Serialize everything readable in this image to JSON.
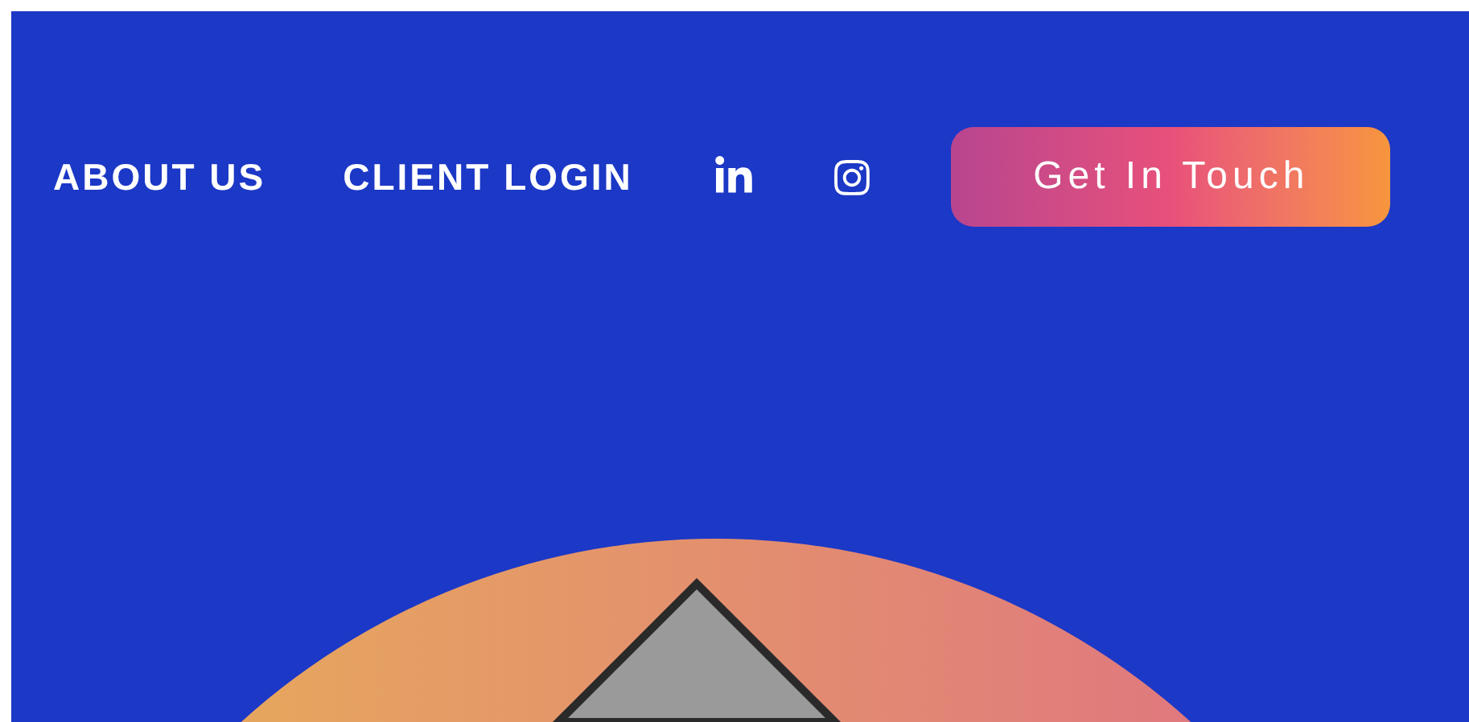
{
  "nav": {
    "links": [
      {
        "label": "ABOUT US"
      },
      {
        "label": "CLIENT LOGIN"
      }
    ],
    "cta_button": "Get In Touch"
  }
}
